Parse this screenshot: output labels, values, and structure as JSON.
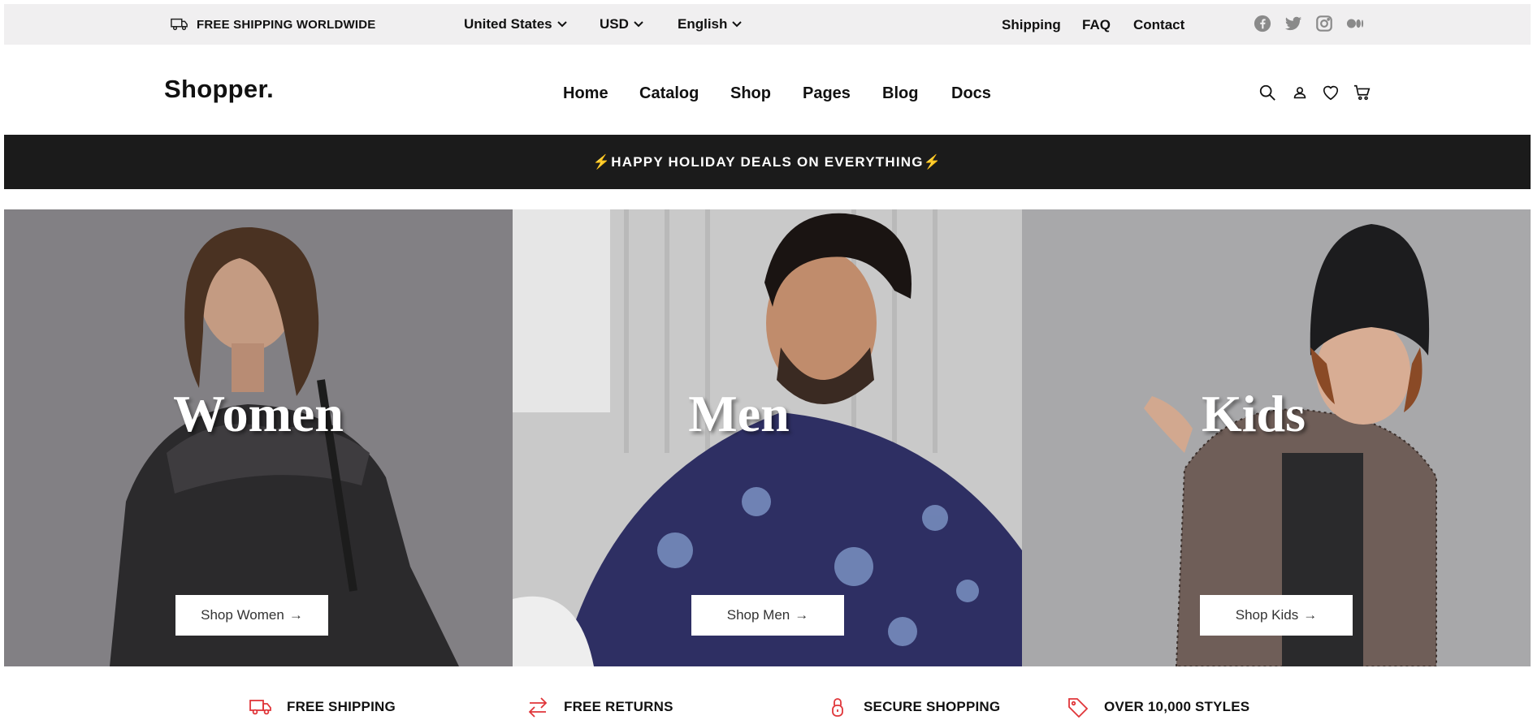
{
  "topbar": {
    "shipping_notice": "FREE SHIPPING WORLDWIDE",
    "country": "United States",
    "currency": "USD",
    "language": "English",
    "links": [
      "Shipping",
      "FAQ",
      "Contact"
    ],
    "social_icons": [
      "facebook-icon",
      "twitter-icon",
      "instagram-icon",
      "medium-icon"
    ]
  },
  "header": {
    "logo": "Shopper.",
    "nav": [
      "Home",
      "Catalog",
      "Shop",
      "Pages",
      "Blog",
      "Docs"
    ],
    "icons": [
      "search-icon",
      "user-icon",
      "heart-icon",
      "cart-icon"
    ]
  },
  "promo": {
    "bolt": "⚡",
    "text": "HAPPY HOLIDAY DEALS ON EVERYTHING"
  },
  "hero": {
    "panels": [
      {
        "title": "Women",
        "button": "Shop Women",
        "arrow": "→"
      },
      {
        "title": "Men",
        "button": "Shop Men",
        "arrow": "→"
      },
      {
        "title": "Kids",
        "button": "Shop Kids",
        "arrow": "→"
      }
    ]
  },
  "features": [
    {
      "label": "FREE SHIPPING",
      "icon": "truck-icon"
    },
    {
      "label": "FREE RETURNS",
      "icon": "exchange-arrows-icon"
    },
    {
      "label": "SECURE SHOPPING",
      "icon": "lock-icon"
    },
    {
      "label": "OVER 10,000 STYLES",
      "icon": "tag-icon"
    }
  ],
  "colors": {
    "topbar_bg": "#f0eff0",
    "promo_bg": "#1b1b1b",
    "accent_red": "#e0363a",
    "bolt": "#f0b43c"
  }
}
